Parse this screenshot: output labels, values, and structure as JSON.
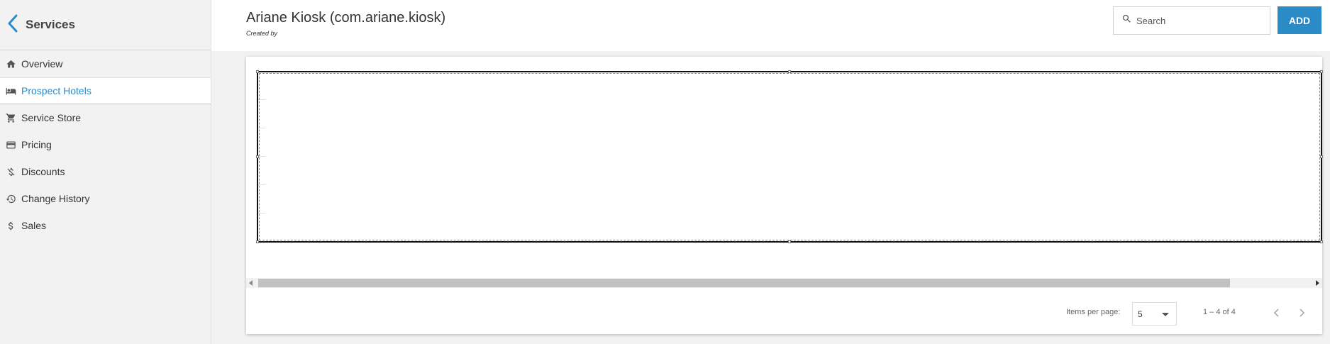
{
  "sidebar": {
    "title": "Services",
    "back_icon": "chevron-left-icon",
    "items": [
      {
        "label": "Overview",
        "icon": "home-icon"
      },
      {
        "label": "Prospect Hotels",
        "icon": "bed-icon",
        "active": true
      },
      {
        "label": "Service Store",
        "icon": "cart-icon"
      },
      {
        "label": "Pricing",
        "icon": "credit-card-icon"
      },
      {
        "label": "Discounts",
        "icon": "money-off-icon"
      },
      {
        "label": "Change History",
        "icon": "history-icon"
      },
      {
        "label": "Sales",
        "icon": "dollar-icon"
      }
    ]
  },
  "header": {
    "title": "Ariane Kiosk (com.ariane.kiosk)",
    "subtitle": "Created by",
    "search_placeholder": "Search",
    "add_label": "ADD"
  },
  "paginator": {
    "items_per_page_label": "Items per page:",
    "items_per_page_value": "5",
    "range_label": "1 – 4 of 4"
  },
  "colors": {
    "accent": "#2b8bc7",
    "sidebar_bg": "#f2f2f2"
  }
}
